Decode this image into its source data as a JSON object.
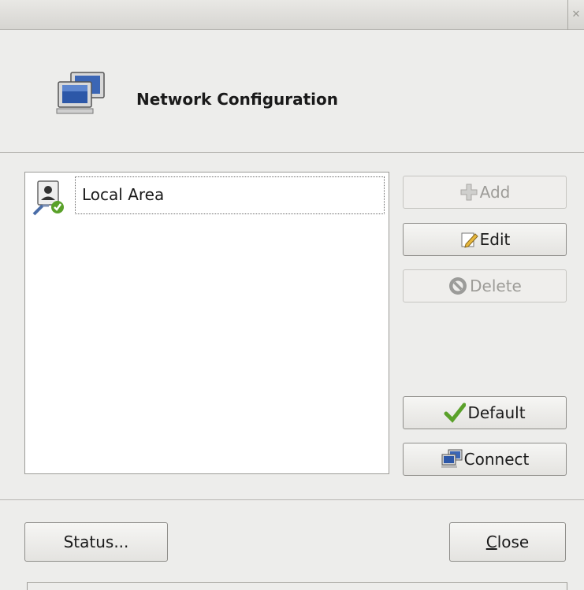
{
  "window": {
    "close_glyph": "✕"
  },
  "header": {
    "title": "Network Configuration",
    "icon": "network-computers-icon"
  },
  "connections": {
    "items": [
      {
        "label": "Local Area",
        "icon": "connection-ok-icon"
      }
    ]
  },
  "actions": {
    "add_label": "Add",
    "edit_label": "Edit",
    "delete_label": "Delete",
    "default_label": "Default",
    "connect_label": "Connect"
  },
  "footer": {
    "status_label": "Status...",
    "close_mnemonic": "C",
    "close_rest": "lose"
  },
  "colors": {
    "background": "#ededeb",
    "disabled_text": "#9d9c98",
    "check_green": "#5aa12a"
  }
}
